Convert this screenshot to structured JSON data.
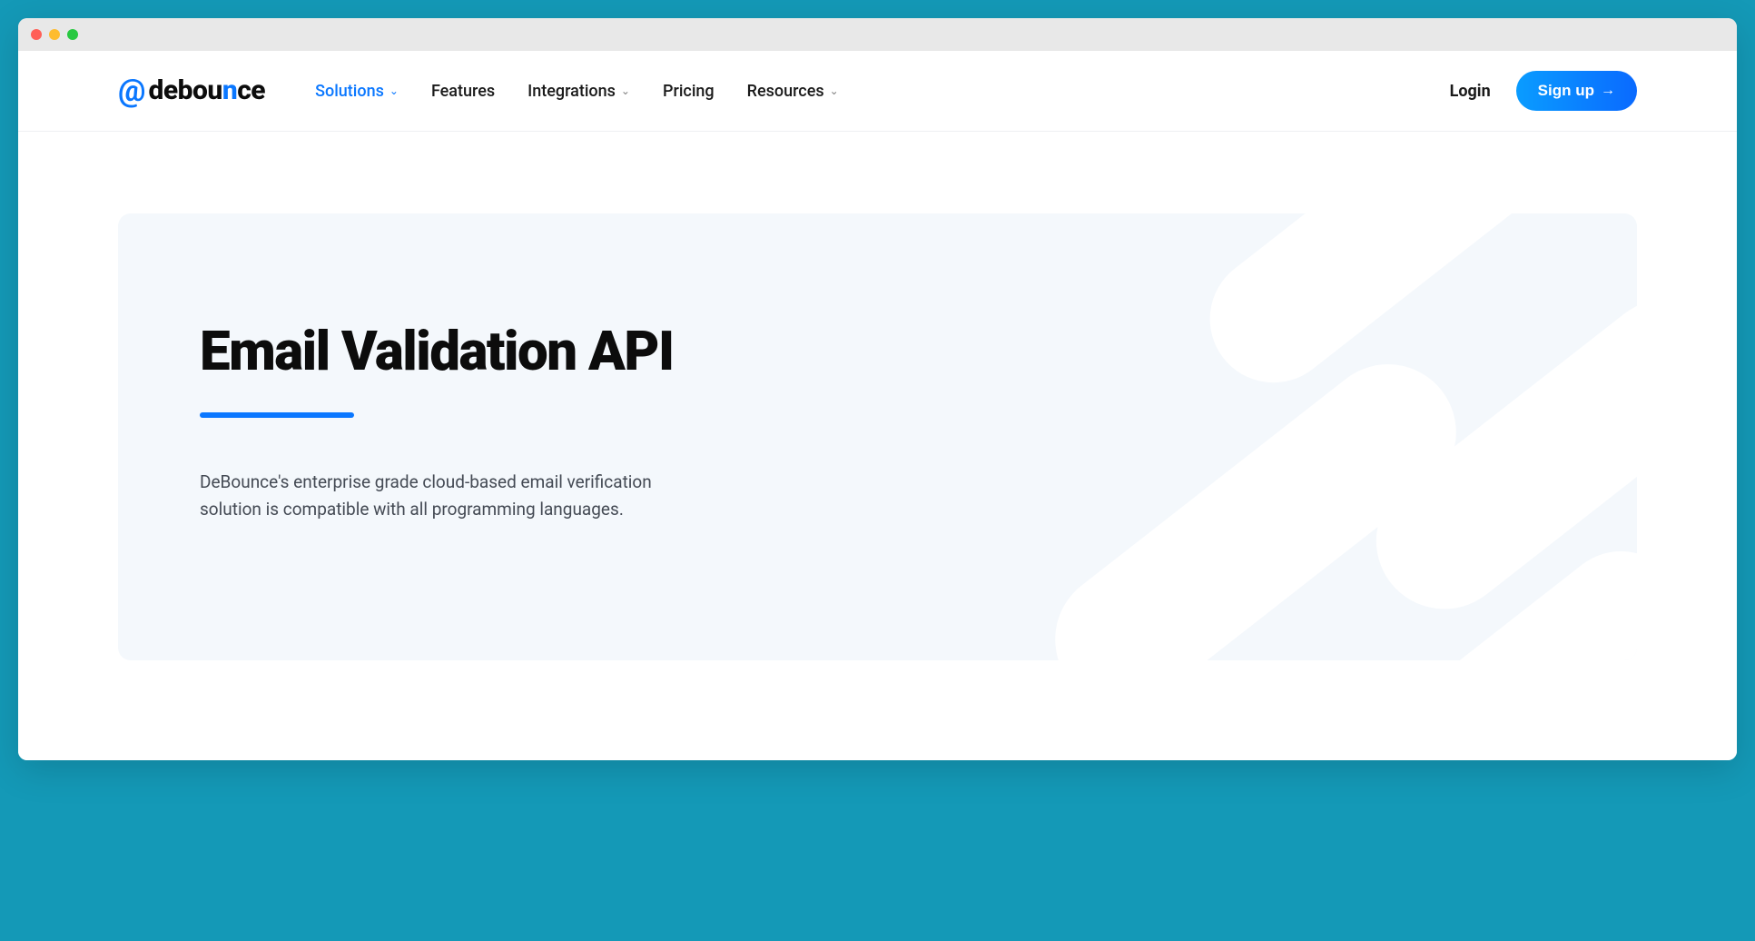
{
  "logo": {
    "at": "@",
    "text_pre": "debou",
    "text_highlight": "n",
    "text_post": "ce"
  },
  "nav": {
    "solutions": "Solutions",
    "features": "Features",
    "integrations": "Integrations",
    "pricing": "Pricing",
    "resources": "Resources"
  },
  "auth": {
    "login": "Login",
    "signup": "Sign up"
  },
  "hero": {
    "title": "Email Validation API",
    "description": "DeBounce's enterprise grade cloud-based email verification solution is compatible with all programming languages."
  }
}
